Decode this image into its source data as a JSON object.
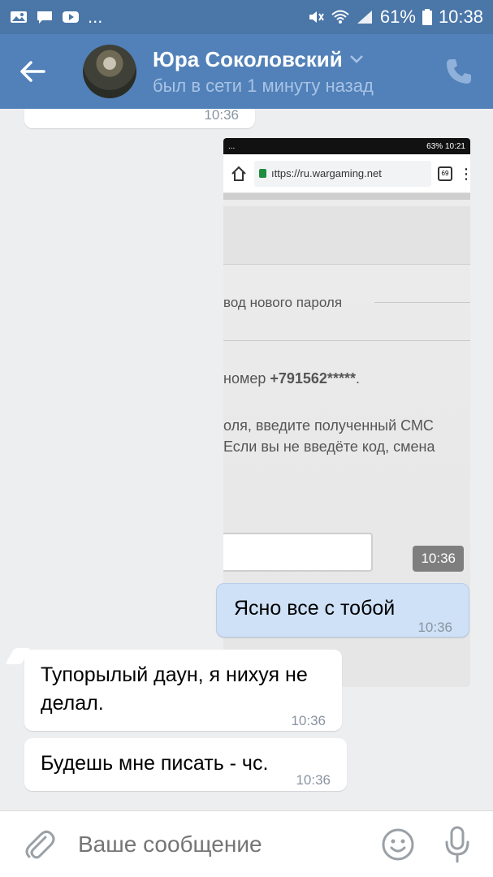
{
  "statusbar": {
    "left_text": "...",
    "battery": "61%",
    "time": "10:38"
  },
  "header": {
    "name": "Юра Соколовский",
    "status": "был в сети 1 минуту назад"
  },
  "messages": {
    "top_partial": {
      "time": "10:36"
    },
    "photo": {
      "status_left": "...",
      "status_right": "63% 10:21",
      "url": "ıttps://ru.wargaming.net",
      "tab_count": "69",
      "line1": "вод нового пароля",
      "line2_prefix": "номер ",
      "line2_number": "+791562*****",
      "line2_suffix": ".",
      "line3": "оля, введите полученный СМС",
      "line4": "Если вы не введёте код, смена",
      "time": "10:36"
    },
    "clear": {
      "text": "Ясно все с тобой",
      "time": "10:36"
    },
    "dumb": {
      "text": "Тупорылый даун, я нихуя не делал.",
      "time": "10:36"
    },
    "chs": {
      "text": "Будешь мне писать - чс.",
      "time": "10:36"
    }
  },
  "input": {
    "placeholder": "Ваше сообщение"
  },
  "colors": {
    "statusbar": "#4a76a8",
    "header": "#5181b8",
    "background": "#edeef0",
    "outgoing_bubble": "#cfe1f7"
  },
  "icons": [
    "gallery-icon",
    "message-icon",
    "youtube-icon",
    "mute-icon",
    "wifi-icon",
    "signal-icon",
    "battery-icon",
    "back-arrow-icon",
    "chevron-down-icon",
    "phone-icon",
    "paperclip-icon",
    "emoji-icon",
    "microphone-icon"
  ]
}
